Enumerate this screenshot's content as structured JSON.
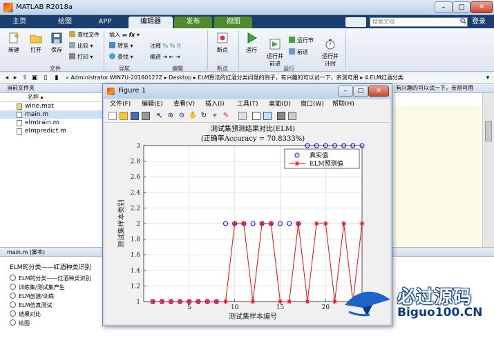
{
  "window": {
    "title": "MATLAB R2018a",
    "min": "–",
    "max": "□",
    "close": "✕"
  },
  "ribbon": {
    "tabs": [
      "主页",
      "绘图",
      "APP",
      "编辑器",
      "发布",
      "视图"
    ],
    "active_tab": "编辑器",
    "search_placeholder": "搜索文档",
    "login": "登录"
  },
  "toolstrip": {
    "file": {
      "new": "新建",
      "open": "打开",
      "save": "保存",
      "find_files": "查找文件",
      "compare": "比较",
      "print": "打印",
      "section": "文件"
    },
    "navigate": {
      "insert": "插入",
      "goto": "转至",
      "find": "查找",
      "section": "导航"
    },
    "edit": {
      "comment": "注释",
      "indent": "缩进",
      "section": "编辑"
    },
    "breakpoints": {
      "breakpoint": "断点",
      "section": "断点"
    },
    "run": {
      "run": "运行",
      "run_advance": "运行并\n前进",
      "run_section": "运行节",
      "advance": "前进",
      "run_time": "运行并\n计时",
      "section": "运行"
    }
  },
  "address": {
    "path": "« Administrator.WIN7U-20180127Z ▸ Desktop ▸ ELM算法的红酒分类问题的例子，有兴趣的可以试一下，亲测可用 ▸ 4.ELM红酒分类"
  },
  "current_folder": {
    "header": "当前文件夹",
    "column_name": "名称 ▴",
    "files": [
      {
        "name": "wine.mat",
        "icon": "mat-file-icon",
        "selected": false
      },
      {
        "name": "main.m",
        "icon": "m-file-icon",
        "selected": true
      },
      {
        "name": "elmtrain.m",
        "icon": "m-file-icon",
        "selected": false
      },
      {
        "name": "elmpredict.m",
        "icon": "m-file-icon",
        "selected": false
      }
    ]
  },
  "details": {
    "header": "main.m  (脚本)",
    "title": "ELM的分类——红酒种类识别",
    "cells": [
      "ELM的分类——红酒种类识别",
      "训练集/测试集产生",
      "ELM创建/训练",
      "ELM仿真测试",
      "结果对比",
      "绘图"
    ]
  },
  "editor": {
    "tab_text": "有兴趣的可以试一下，亲测可用"
  },
  "figure": {
    "title": "Figure 1",
    "menu": [
      "文件(F)",
      "编辑(E)",
      "查看(V)",
      "插入(I)",
      "工具(T)",
      "桌面(D)",
      "窗口(W)",
      "帮助(H)"
    ]
  },
  "chart_data": {
    "type": "line",
    "title": "测试集预测结果对比(ELM)",
    "subtitle": "(正确率Accuracy = 70.8333%)",
    "xlabel": "测试集样本编号",
    "ylabel": "测试集样本类别",
    "xlim": [
      0,
      24
    ],
    "ylim": [
      1,
      3
    ],
    "xticks": [
      5,
      10,
      15,
      20
    ],
    "yticks": [
      1,
      1.2,
      1.4,
      1.6,
      1.8,
      2,
      2.2,
      2.4,
      2.6,
      2.8,
      3
    ],
    "grid": true,
    "legend_position": "top-right",
    "series": [
      {
        "name": "真实值",
        "marker": "circle",
        "color": "#0000ff",
        "x": [
          1,
          2,
          3,
          4,
          5,
          6,
          7,
          8,
          9,
          10,
          11,
          12,
          13,
          14,
          15,
          16,
          17,
          18,
          19,
          20,
          21,
          22,
          23,
          24
        ],
        "values": [
          1,
          1,
          1,
          1,
          1,
          1,
          1,
          1,
          2,
          2,
          2,
          2,
          2,
          2,
          2,
          2,
          2,
          3,
          3,
          3,
          3,
          3,
          3,
          3
        ]
      },
      {
        "name": "ELM预测值",
        "marker": "star",
        "color": "#ff0000",
        "x": [
          1,
          2,
          3,
          4,
          5,
          6,
          7,
          8,
          9,
          10,
          11,
          12,
          13,
          14,
          15,
          16,
          17,
          18,
          19,
          20,
          21,
          22,
          23,
          24
        ],
        "values": [
          1,
          1,
          1,
          1,
          1,
          1,
          1,
          1,
          1,
          2,
          2,
          1,
          2,
          2,
          1,
          1,
          2,
          1,
          2,
          2,
          1,
          2,
          1,
          2
        ]
      }
    ]
  },
  "watermark": {
    "cn": "必过源码",
    "en": "Biguo100.CN"
  }
}
